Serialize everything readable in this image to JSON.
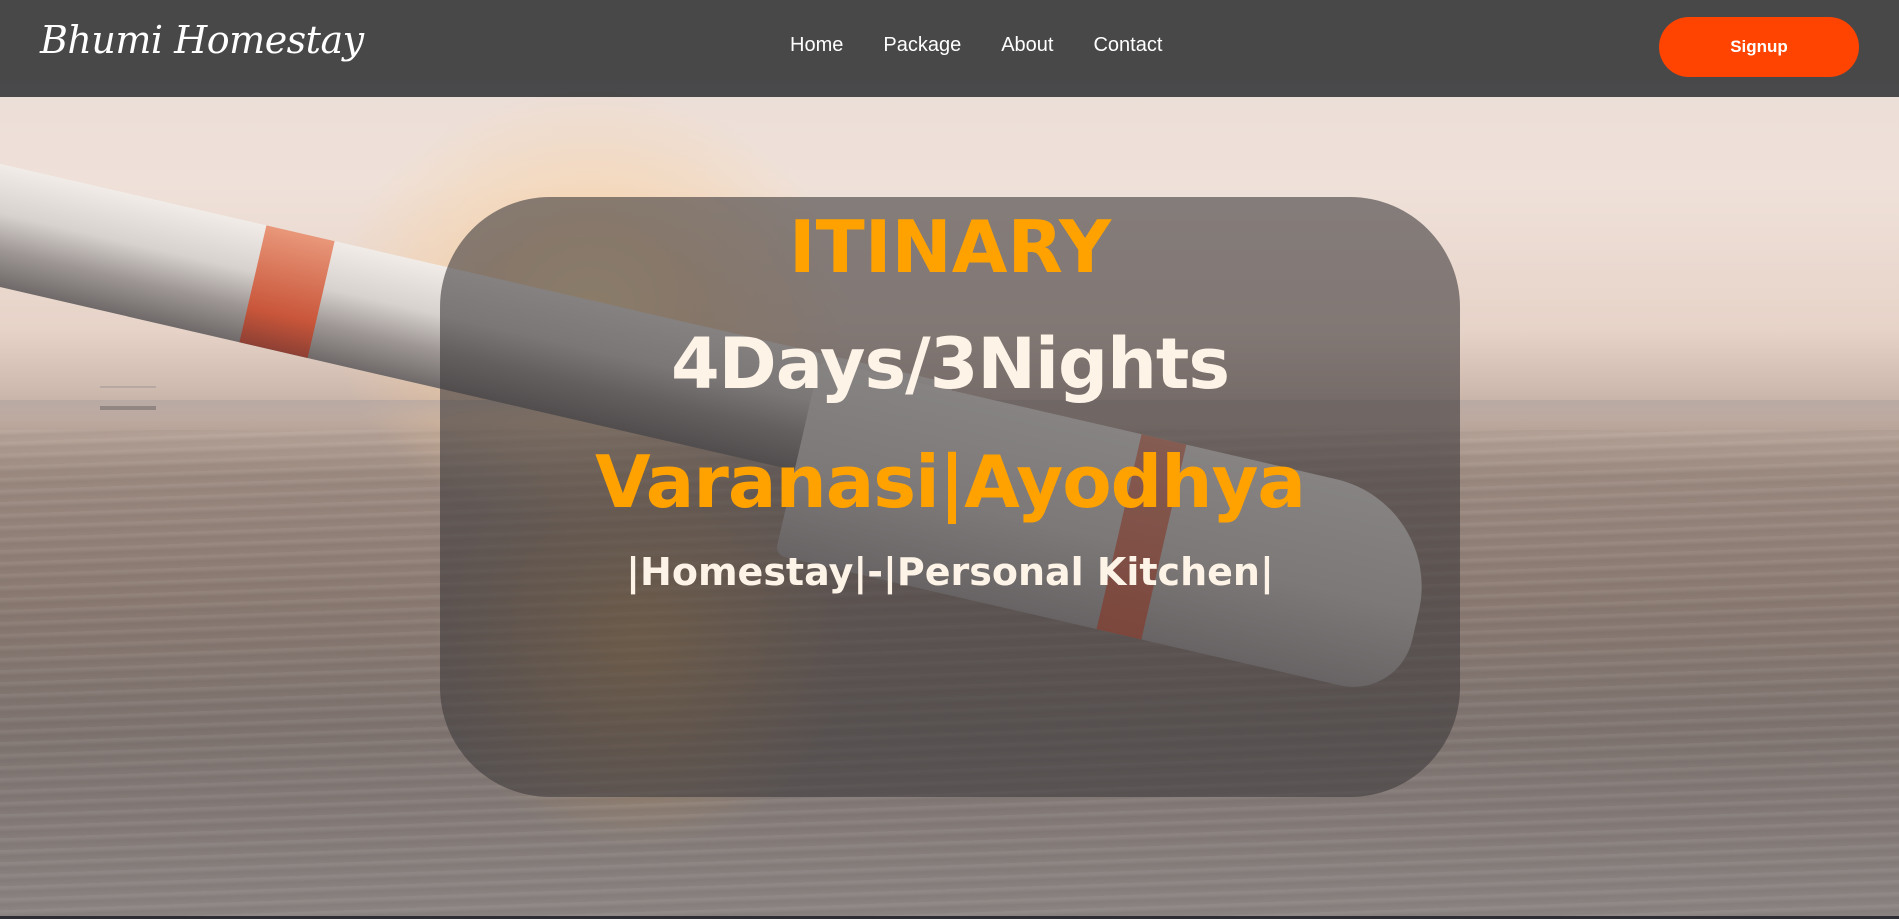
{
  "header": {
    "brand": "Bhumi Homestay",
    "nav": [
      {
        "label": "Home"
      },
      {
        "label": "Package"
      },
      {
        "label": "About"
      },
      {
        "label": "Contact"
      }
    ],
    "signup_label": "Signup"
  },
  "hero": {
    "title": "ITINARY",
    "duration": "4Days/3Nights",
    "places": "Varanasi|Ayodhya",
    "features": "|Homestay|-|Personal Kitchen|"
  },
  "colors": {
    "accent_orange": "#ffa200",
    "signup_button": "#fe4400",
    "navbar_bg": "#3c3c3e",
    "text_light": "#fdf3e7"
  }
}
